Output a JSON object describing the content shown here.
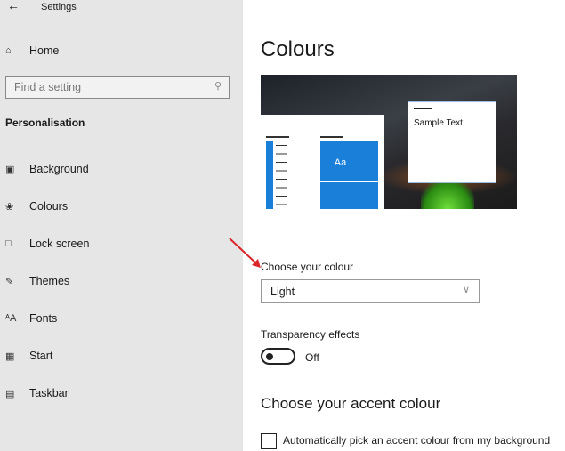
{
  "window": {
    "title": "Settings",
    "back_icon": "arrow-left-icon"
  },
  "sidebar": {
    "home": "Home",
    "search": {
      "placeholder": "Find a setting"
    },
    "section": "Personalisation",
    "items": [
      {
        "label": "Background",
        "icon": "image-icon"
      },
      {
        "label": "Colours",
        "icon": "palette-icon"
      },
      {
        "label": "Lock screen",
        "icon": "lock-screen-icon"
      },
      {
        "label": "Themes",
        "icon": "themes-icon"
      },
      {
        "label": "Fonts",
        "icon": "fonts-icon"
      },
      {
        "label": "Start",
        "icon": "start-icon"
      },
      {
        "label": "Taskbar",
        "icon": "taskbar-icon"
      }
    ]
  },
  "main": {
    "title": "Colours",
    "preview": {
      "tile_text": "Aa",
      "sample_text": "Sample Text",
      "accent": "#1a7fd9"
    },
    "choose_colour": {
      "label": "Choose your colour",
      "value": "Light"
    },
    "transparency": {
      "label": "Transparency effects",
      "state": "Off"
    },
    "accent_heading": "Choose your accent colour",
    "auto_pick": {
      "label": "Automatically pick an accent colour from my background",
      "checked": false
    }
  },
  "annotation": {
    "arrow_color": "#d9262b"
  }
}
